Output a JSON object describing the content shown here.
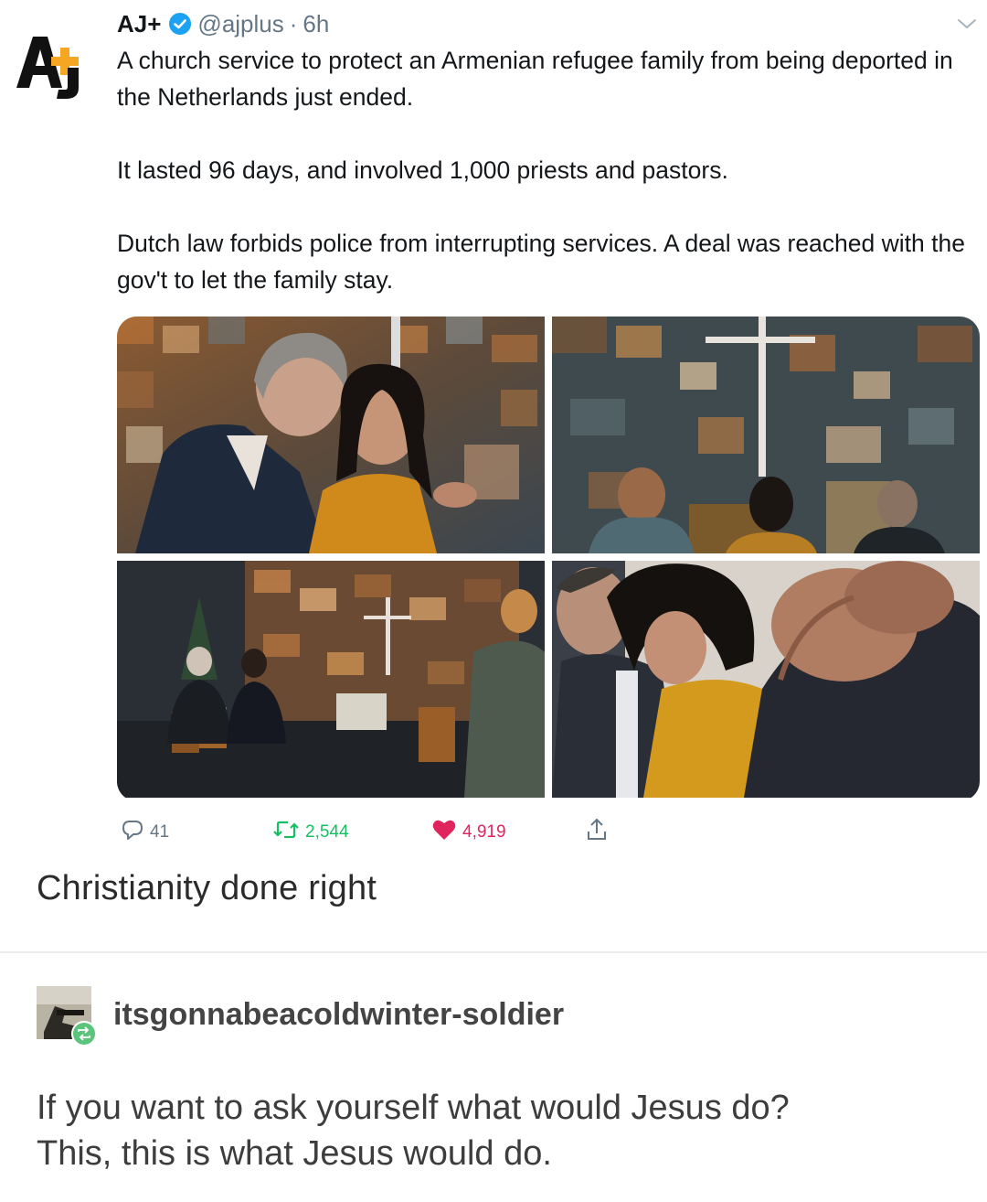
{
  "tweet": {
    "author_name": "AJ+",
    "handle": "@ajplus",
    "separator": "·",
    "time": "6h",
    "paragraphs": [
      "A church service to protect an Armenian refugee family from being deported in the Netherlands just ended.",
      "It lasted 96 days, and involved 1,000 priests and pastors.",
      "Dutch law forbids police from interrupting services. A deal was reached with the gov't to let the family stay."
    ],
    "stats": {
      "replies": "41",
      "retweets": "2,544",
      "likes": "4,919"
    },
    "colors": {
      "verified": "#1da1f2",
      "retweet": "#17bf63",
      "like": "#e0245e",
      "muted": "#657786",
      "logo_yellow": "#f5a623"
    },
    "icons": [
      "verified-badge-icon",
      "chevron-down-icon",
      "reply-icon",
      "retweet-icon",
      "heart-icon",
      "share-icon"
    ]
  },
  "comment": "Christianity done right",
  "reblog": {
    "username": "itsgonnabeacoldwinter-soldier",
    "text_lines": [
      "If you want to ask yourself what would Jesus do?",
      "This, this is what Jesus would do."
    ],
    "icons": [
      "reblog-icon"
    ]
  }
}
